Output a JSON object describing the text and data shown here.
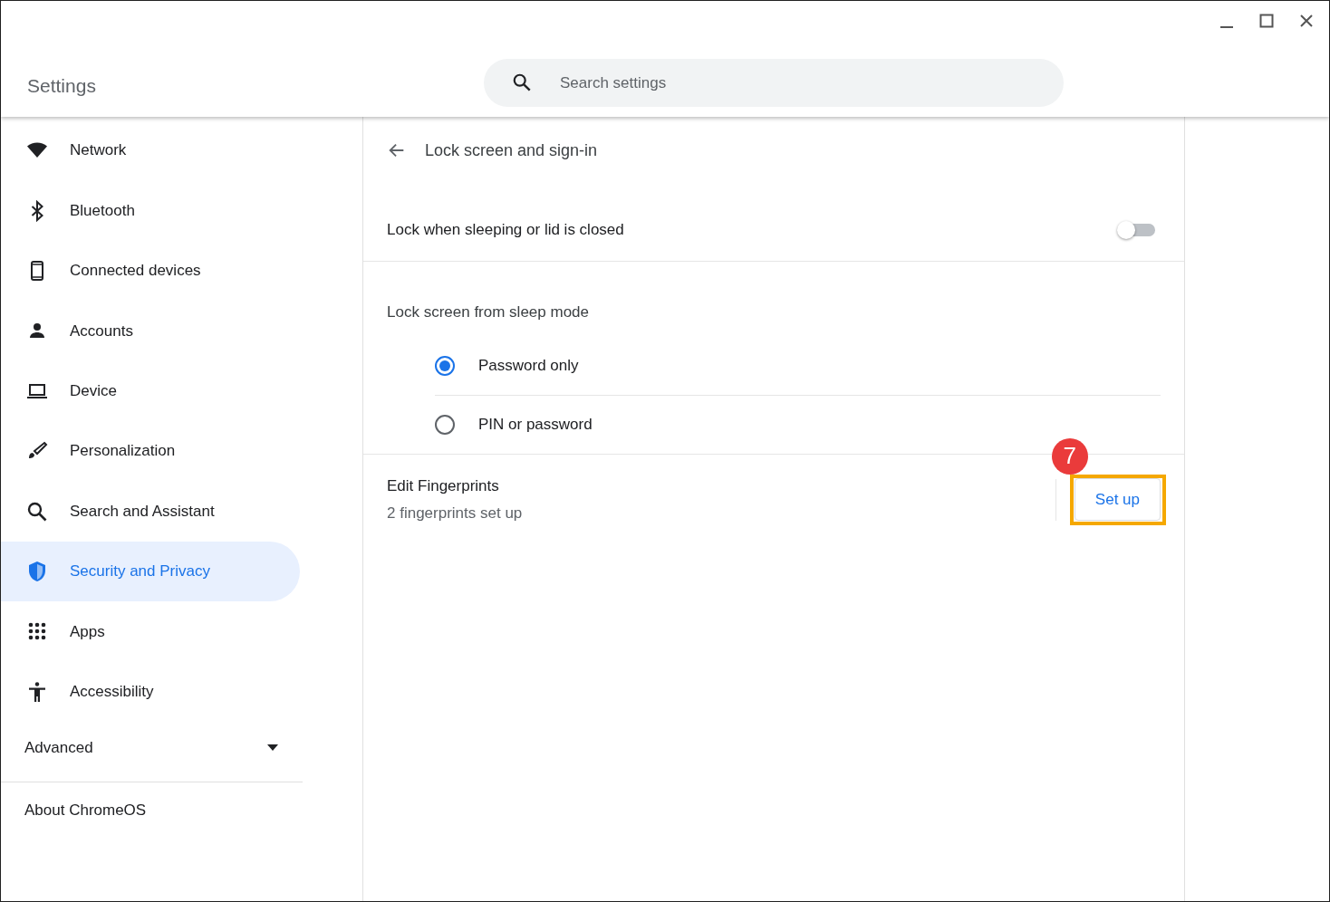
{
  "window": {
    "title": "Settings"
  },
  "search": {
    "placeholder": "Search settings"
  },
  "sidebar": {
    "items": [
      {
        "label": "Network",
        "selected": false
      },
      {
        "label": "Bluetooth",
        "selected": false
      },
      {
        "label": "Connected devices",
        "selected": false
      },
      {
        "label": "Accounts",
        "selected": false
      },
      {
        "label": "Device",
        "selected": false
      },
      {
        "label": "Personalization",
        "selected": false
      },
      {
        "label": "Search and Assistant",
        "selected": false
      },
      {
        "label": "Security and Privacy",
        "selected": true
      },
      {
        "label": "Apps",
        "selected": false
      },
      {
        "label": "Accessibility",
        "selected": false
      }
    ],
    "advanced": {
      "label": "Advanced",
      "expanded": false
    },
    "about": "About ChromeOS"
  },
  "page": {
    "title": "Lock screen and sign-in",
    "toggle_row": {
      "label": "Lock when sleeping or lid is closed",
      "on": false
    },
    "lock_section": {
      "heading": "Lock screen from sleep mode",
      "options": [
        {
          "label": "Password only",
          "selected": true
        },
        {
          "label": "PIN or password",
          "selected": false
        }
      ]
    },
    "fingerprints": {
      "title": "Edit Fingerprints",
      "subtitle": "2 fingerprints set up",
      "button": "Set up",
      "callout": "7"
    }
  }
}
